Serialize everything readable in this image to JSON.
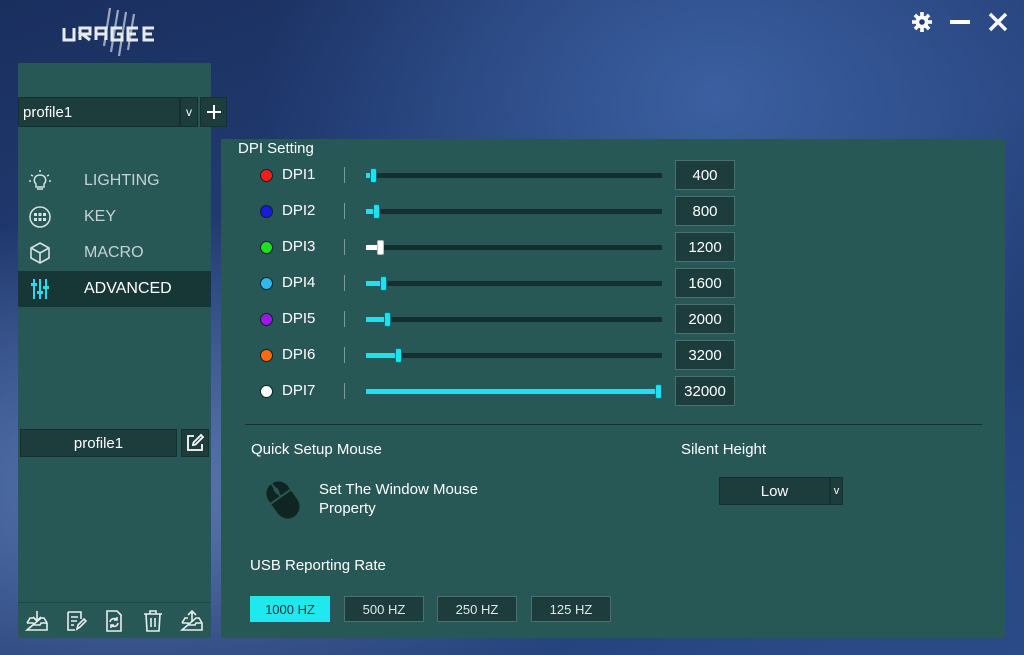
{
  "app": {
    "logo_text": "URAGE"
  },
  "sidebar": {
    "profile_select": "profile1",
    "profile_caret": "v",
    "nav": [
      {
        "label": "LIGHTING",
        "icon": "lightbulb-icon",
        "active": false
      },
      {
        "label": "KEY",
        "icon": "keyboard-icon",
        "active": false
      },
      {
        "label": "MACRO",
        "icon": "cube-icon",
        "active": false
      },
      {
        "label": "ADVANCED",
        "icon": "sliders-icon",
        "active": true
      }
    ],
    "profile_name": "profile1",
    "footer_icons": [
      "import-icon",
      "notes-icon",
      "refresh-icon",
      "trash-icon",
      "export-icon"
    ]
  },
  "dpi": {
    "title": "DPI Setting",
    "max": 32000,
    "rows": [
      {
        "label": "DPI1",
        "value": "400",
        "level": 400,
        "color": "#ff1a1a"
      },
      {
        "label": "DPI2",
        "value": "800",
        "level": 800,
        "color": "#1a1adc"
      },
      {
        "label": "DPI3",
        "value": "1200",
        "level": 1200,
        "color": "#22dd22"
      },
      {
        "label": "DPI4",
        "value": "1600",
        "level": 1600,
        "color": "#2fb8f0"
      },
      {
        "label": "DPI5",
        "value": "2000",
        "level": 2000,
        "color": "#9b18e6"
      },
      {
        "label": "DPI6",
        "value": "3200",
        "level": 3200,
        "color": "#ff6a10"
      },
      {
        "label": "DPI7",
        "value": "32000",
        "level": 32000,
        "color": "#ffffff"
      }
    ]
  },
  "quick_setup": {
    "title": "Quick Setup Mouse",
    "line1": "Set The Window Mouse",
    "line2": "Property"
  },
  "silent_height": {
    "title": "Silent Height",
    "value": "Low",
    "caret": "v"
  },
  "usb_rate": {
    "title": "USB Reporting Rate",
    "options": [
      "1000 HZ",
      "500 HZ",
      "250 HZ",
      "125 HZ"
    ],
    "selected": "1000 HZ"
  },
  "colors": {
    "accent": "#1fe0ee",
    "panel": "#285856",
    "field": "#1c3d3c"
  }
}
